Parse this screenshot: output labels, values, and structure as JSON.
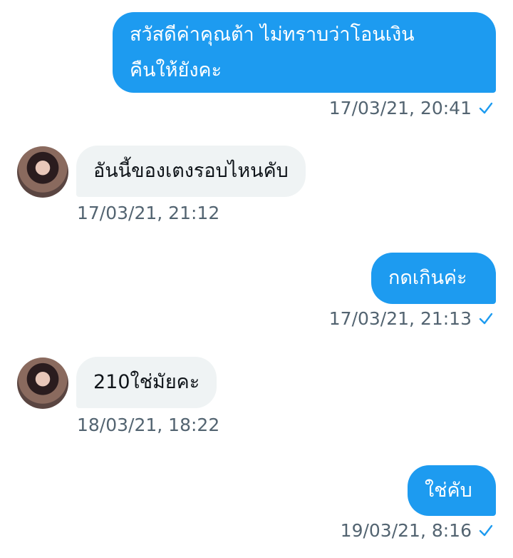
{
  "messages": [
    {
      "side": "out",
      "lines": [
        "สวัสดีค่าคุณต้า ไม่ทราบว่าโอนเงิน",
        "คืนให้ยังคะ"
      ],
      "time": "17/03/21, 20:41",
      "read_icon": "check-icon"
    },
    {
      "side": "in",
      "lines": [
        "อันนี้ของเตงรอบไหนคับ"
      ],
      "time": "17/03/21, 21:12",
      "avatar": "avatar"
    },
    {
      "side": "out",
      "lines": [
        "กดเกินค่ะ"
      ],
      "time": "17/03/21, 21:13",
      "read_icon": "check-icon"
    },
    {
      "side": "in",
      "lines": [
        "210ใช่มัยคะ"
      ],
      "time": "18/03/21, 18:22",
      "avatar": "avatar"
    },
    {
      "side": "out",
      "lines": [
        "ใช่คับ"
      ],
      "time": "19/03/21, 8:16",
      "read_icon": "check-icon"
    }
  ],
  "colors": {
    "outgoing_bubble": "#1d9bf0",
    "incoming_bubble": "#eff3f4",
    "timestamp": "#536471",
    "check": "#1d9bf0"
  }
}
